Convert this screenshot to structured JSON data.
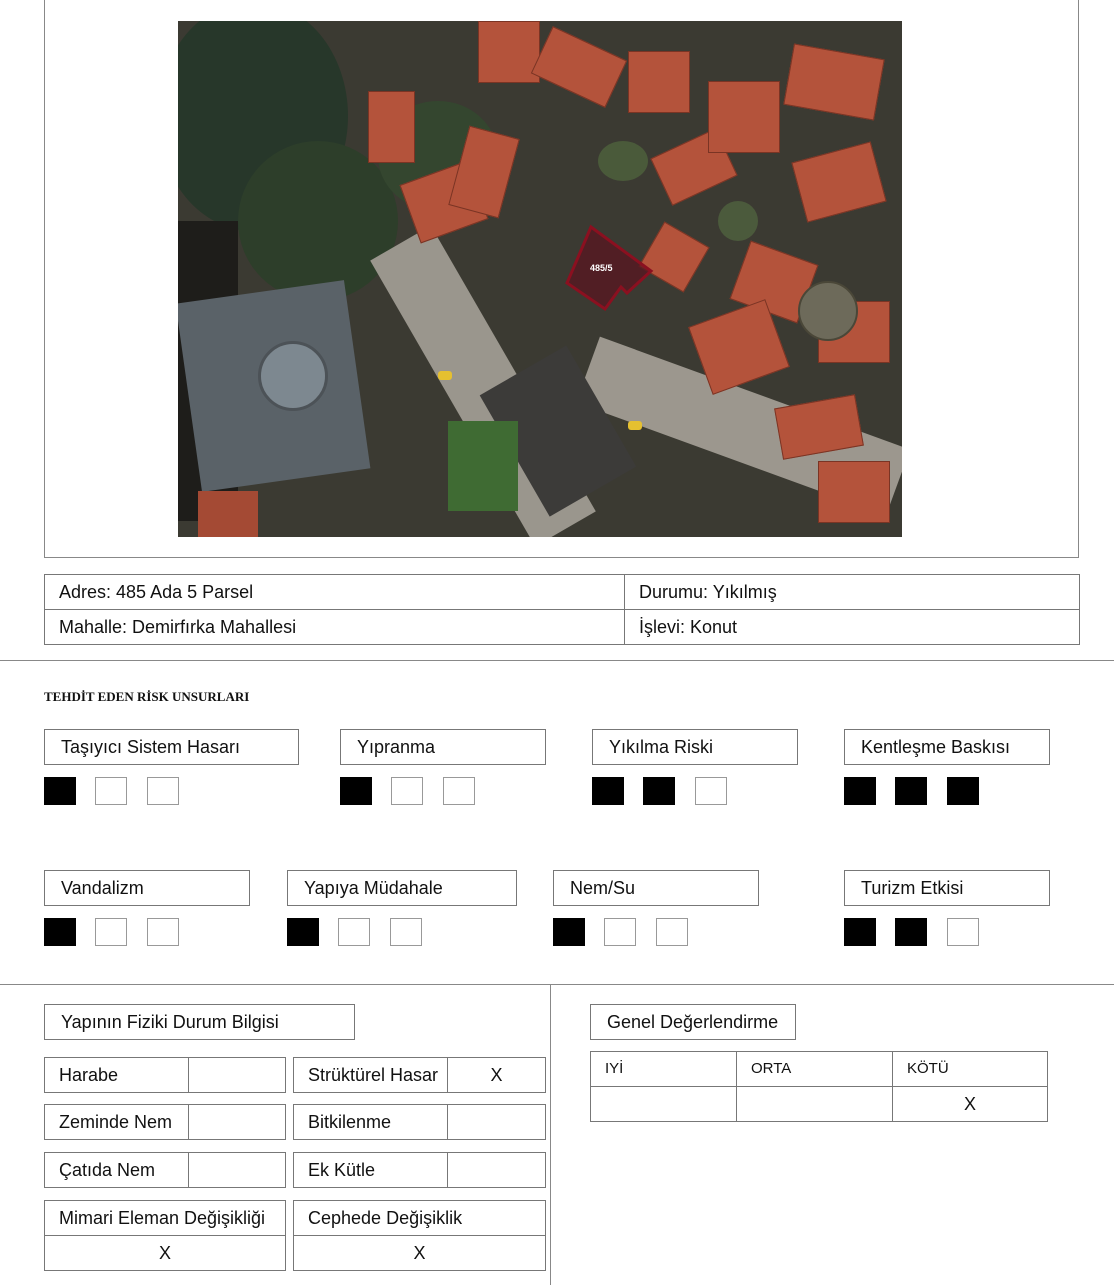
{
  "map": {
    "parcel_label": "485/5",
    "icons": [
      "satellite-image",
      "parcel-outline"
    ]
  },
  "info": {
    "address": "Adres: 485 Ada 5 Parsel",
    "neighborhood": "Mahalle: Demirfırka Mahallesi",
    "status": "Durumu: Yıkılmış",
    "function": "İşlevi: Konut"
  },
  "risks": {
    "title": "TEHDİT EDEN RİSK UNSURLARI",
    "items": [
      {
        "label": "Taşıyıcı Sistem Hasarı",
        "level": 1
      },
      {
        "label": "Yıpranma",
        "level": 1
      },
      {
        "label": "Yıkılma Riski",
        "level": 2
      },
      {
        "label": "Kentleşme Baskısı",
        "level": 3
      },
      {
        "label": "Vandalizm",
        "level": 1
      },
      {
        "label": "Yapıya Müdahale",
        "level": 1
      },
      {
        "label": "Nem/Su",
        "level": 1
      },
      {
        "label": "Turizm Etkisi",
        "level": 2
      }
    ]
  },
  "physical": {
    "title": "Yapının Fiziki Durum Bilgisi",
    "rows": [
      {
        "left_label": "Harabe",
        "left_value": "",
        "right_label": "Strüktürel Hasar",
        "right_value": "X"
      },
      {
        "left_label": "Zeminde Nem",
        "left_value": "",
        "right_label": "Bitkilenme",
        "right_value": ""
      },
      {
        "left_label": "Çatıda Nem",
        "left_value": "",
        "right_label": "Ek Kütle",
        "right_value": ""
      }
    ],
    "arch_label": "Mimari Eleman Değişikliği",
    "arch_value": "X",
    "facade_label": "Cephede Değişiklik",
    "facade_value": "X"
  },
  "evaluation": {
    "title": "Genel Değerlendirme",
    "headers": [
      "IYİ",
      "ORTA",
      "KÖTÜ"
    ],
    "values": [
      "",
      "",
      "X"
    ]
  },
  "colors": {
    "filled_square": "#000000",
    "parcel_outline": "#8b1020"
  }
}
